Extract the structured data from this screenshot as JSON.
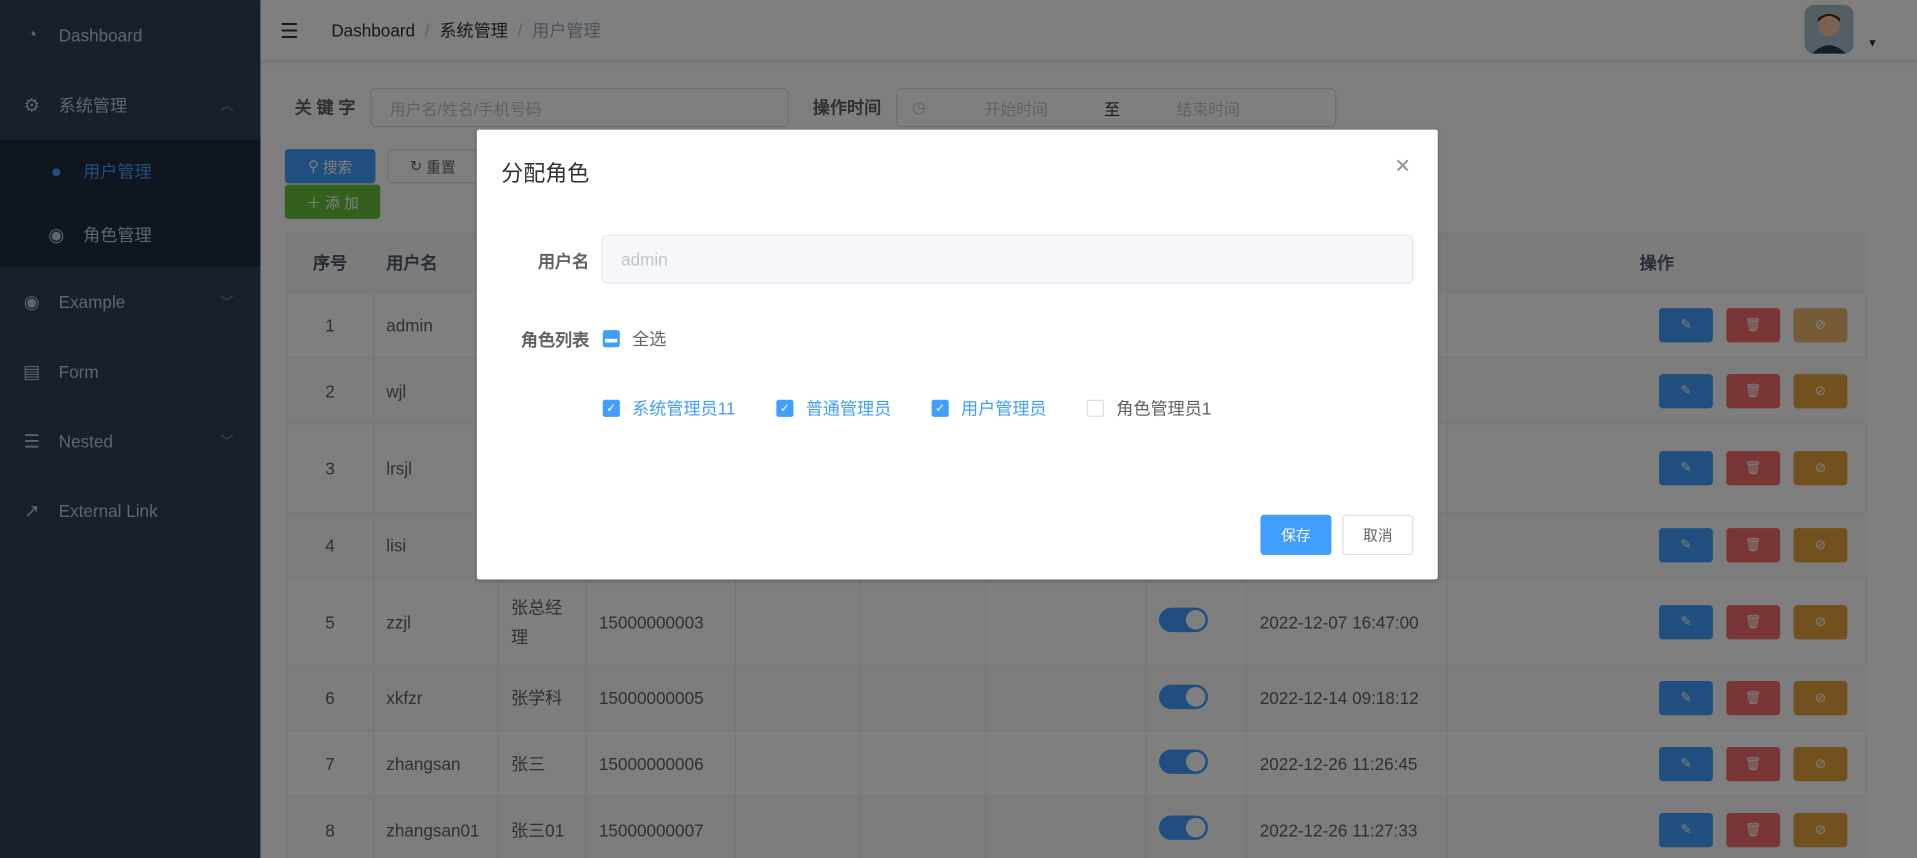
{
  "sidebar": {
    "items": [
      {
        "label": "Dashboard",
        "icon": "dashboard-icon"
      },
      {
        "label": "系统管理",
        "icon": "gear-icon",
        "expanded": true,
        "children": [
          {
            "label": "用户管理",
            "icon": "user-icon",
            "active": true
          },
          {
            "label": "角色管理",
            "icon": "role-icon"
          }
        ]
      },
      {
        "label": "Example",
        "icon": "example-icon"
      },
      {
        "label": "Form",
        "icon": "form-icon"
      },
      {
        "label": "Nested",
        "icon": "nested-icon"
      },
      {
        "label": "External Link",
        "icon": "external-link-icon"
      }
    ]
  },
  "navbar": {
    "breadcrumb": [
      "Dashboard",
      "系统管理",
      "用户管理"
    ],
    "separator": "/"
  },
  "filter": {
    "keyword_label": "关 键 字",
    "keyword_placeholder": "用户名/姓名/手机号码",
    "time_label": "操作时间",
    "start_placeholder": "开始时间",
    "range_sep": "至",
    "end_placeholder": "结束时间"
  },
  "toolbar": {
    "search": "搜索",
    "reset": "重置",
    "add": "添 加"
  },
  "table": {
    "headers": [
      "序号",
      "用户名",
      "",
      "",
      "",
      "",
      "",
      "",
      "",
      "操作"
    ],
    "rows": [
      {
        "no": "1",
        "username": "admin",
        "name": "",
        "phone": "",
        "time": ""
      },
      {
        "no": "2",
        "username": "wjl",
        "name": "",
        "phone": "",
        "time": ""
      },
      {
        "no": "3",
        "username": "lrsjl",
        "name": "",
        "phone": "",
        "time": ""
      },
      {
        "no": "4",
        "username": "lisi",
        "name": "",
        "phone": "",
        "time": ""
      },
      {
        "no": "5",
        "username": "zzjl",
        "name": "张总经理",
        "phone": "15000000003",
        "time": "2022-12-07 16:47:00"
      },
      {
        "no": "6",
        "username": "xkfzr",
        "name": "张学科",
        "phone": "15000000005",
        "time": "2022-12-14 09:18:12"
      },
      {
        "no": "7",
        "username": "zhangsan",
        "name": "张三",
        "phone": "15000000006",
        "time": "2022-12-26 11:26:45"
      },
      {
        "no": "8",
        "username": "zhangsan01",
        "name": "张三01",
        "phone": "15000000007",
        "time": "2022-12-26 11:27:33"
      }
    ]
  },
  "dialog": {
    "title": "分配角色",
    "username_label": "用户名",
    "username_value": "admin",
    "roles_label": "角色列表",
    "select_all": "全选",
    "roles": [
      {
        "label": "系统管理员11",
        "checked": true
      },
      {
        "label": "普通管理员",
        "checked": true
      },
      {
        "label": "用户管理员",
        "checked": true
      },
      {
        "label": "角色管理员1",
        "checked": false
      }
    ],
    "save": "保存",
    "cancel": "取消"
  },
  "colors": {
    "primary": "#409EFF",
    "success": "#67C23A",
    "danger": "#F56C6C",
    "warning": "#E6A23C",
    "sidebar": "#304156"
  }
}
